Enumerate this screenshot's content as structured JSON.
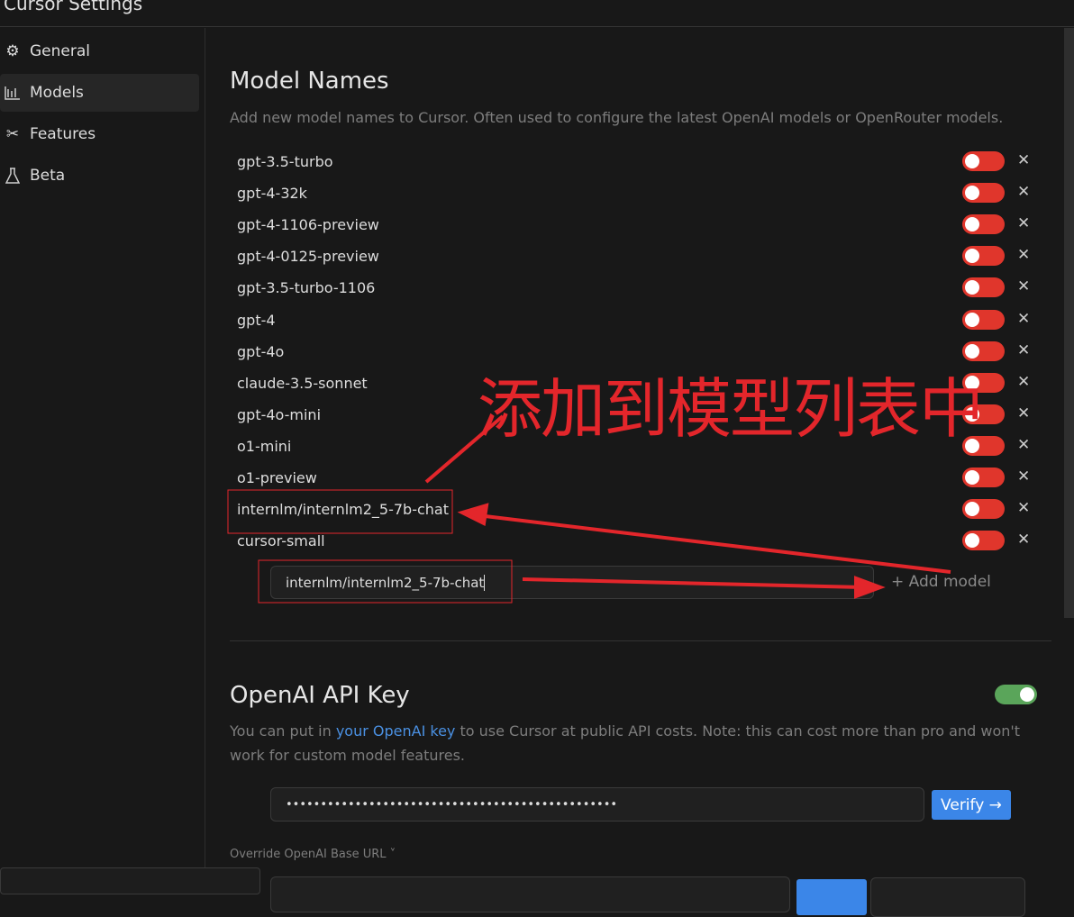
{
  "app_title": "Cursor Settings",
  "sidebar": {
    "items": [
      {
        "label": "General",
        "icon": "gear-icon"
      },
      {
        "label": "Models",
        "icon": "bar-chart-icon"
      },
      {
        "label": "Features",
        "icon": "tools-icon"
      },
      {
        "label": "Beta",
        "icon": "flask-icon"
      }
    ]
  },
  "model_names": {
    "title": "Model Names",
    "description": "Add new model names to Cursor. Often used to configure the latest OpenAI models or OpenRouter models.",
    "models": [
      {
        "name": "gpt-3.5-turbo",
        "enabled": false
      },
      {
        "name": "gpt-4-32k",
        "enabled": false
      },
      {
        "name": "gpt-4-1106-preview",
        "enabled": false
      },
      {
        "name": "gpt-4-0125-preview",
        "enabled": false
      },
      {
        "name": "gpt-3.5-turbo-1106",
        "enabled": false
      },
      {
        "name": "gpt-4",
        "enabled": false
      },
      {
        "name": "gpt-4o",
        "enabled": false
      },
      {
        "name": "claude-3.5-sonnet",
        "enabled": false
      },
      {
        "name": "gpt-4o-mini",
        "enabled": false
      },
      {
        "name": "o1-mini",
        "enabled": false
      },
      {
        "name": "o1-preview",
        "enabled": false
      },
      {
        "name": "internlm/internlm2_5-7b-chat",
        "enabled": false
      },
      {
        "name": "cursor-small",
        "enabled": false
      }
    ],
    "input_value": "internlm/internlm2_5-7b-chat",
    "add_label": "+ Add model"
  },
  "openai": {
    "title": "OpenAI API Key",
    "desc_before": "You can put in ",
    "link": "your OpenAI key",
    "desc_after": " to use Cursor at public API costs. Note: this can cost more than pro and won't work for custom model features.",
    "key_value": "••••••••••••••••••••••••••••••••••••••••••••••••",
    "verify_label": "Verify →",
    "override_label": "Override OpenAI Base URL ˅",
    "enabled": true
  },
  "annotation": {
    "text": "添加到模型列表中",
    "color": "#e3262b"
  }
}
